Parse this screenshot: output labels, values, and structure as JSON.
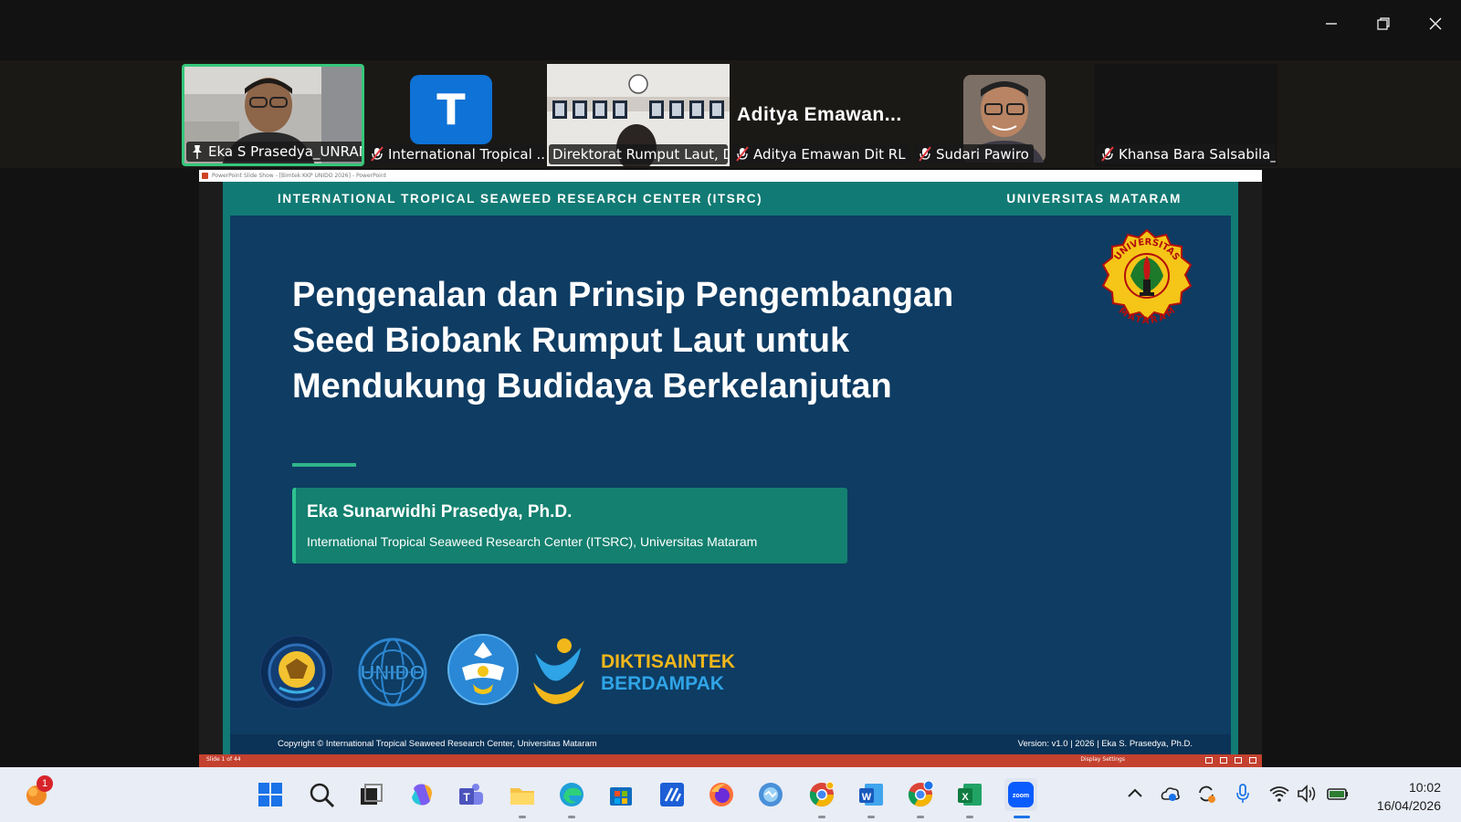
{
  "window": {
    "controls": [
      "minimize-icon",
      "restore-icon",
      "close-icon"
    ]
  },
  "participants": [
    {
      "name": "Eka S Prasedya_UNRAM",
      "mic": "pin-icon",
      "active": true,
      "video": "camera"
    },
    {
      "name": "International Tropical ...",
      "mic": "mic-muted-icon",
      "avatar_letter": "T"
    },
    {
      "name": "Direktorat Rumput Laut, D...",
      "mic": "none",
      "video": "camera"
    },
    {
      "name": "Aditya Emawan Dit RL",
      "mic": "mic-muted-icon",
      "big_name": "Aditya  Emawan..."
    },
    {
      "name": "Sudari Pawiro",
      "mic": "mic-muted-icon",
      "video": "photo"
    },
    {
      "name": "Khansa Bara Salsabila_...",
      "mic": "mic-muted-icon",
      "video": "off"
    }
  ],
  "powerpoint": {
    "titlebar": "PowerPoint Slide Show - [Bimtek KKP UNIDO 2026] - PowerPoint",
    "status_left": "Slide 1 of 44",
    "status_right": "Display Settings"
  },
  "slide": {
    "header_left": "INTERNATIONAL TROPICAL SEAWEED RESEARCH CENTER (ITSRC)",
    "header_right": "UNIVERSITAS MATARAM",
    "title_lines": [
      "Pengenalan dan Prinsip Pengembangan",
      "Seed Biobank Rumput Laut untuk",
      "Mendukung Budidaya Berkelanjutan"
    ],
    "author_name": "Eka Sunarwidhi Prasedya, Ph.D.",
    "author_affiliation": "International Tropical Seaweed Research Center (ITSRC), Universitas Mataram",
    "logo_top_text": "UNIVERSITAS",
    "logo_bottom_text": "MATARAM",
    "logos": [
      "kkp-logo",
      "unido-logo",
      "tut-wuri-handayani-logo",
      "diktisaintek-logo"
    ],
    "unido_text": "UNIDO",
    "dikti_line1": "DIKTISAINTEK",
    "dikti_line2": "BERDAMPAK",
    "footer_left": "Copyright © International Tropical Seaweed Research Center, Universitas Mataram",
    "footer_right": "Version: v1.0 | 2026 | Eka S. Prasedya, Ph.D."
  },
  "taskbar": {
    "notification_count": "1",
    "apps": [
      "start-icon",
      "search-icon",
      "task-view-icon",
      "copilot-icon",
      "teams-icon",
      "file-explorer-icon",
      "edge-icon",
      "store-icon",
      "zoom-workplace-icon",
      "firefox-icon",
      "network-app-icon",
      "chrome-icon",
      "word-icon",
      "chrome-profile-icon",
      "excel-icon",
      "zoom-icon"
    ],
    "time": "10:02",
    "date": "16/04/2026"
  },
  "colors": {
    "slide_teal": "#127a74",
    "slide_navy": "#0e3c63",
    "accent_green": "#2fb58a",
    "active_speaker": "#35c77a",
    "ppt_status_red": "#c4412f"
  }
}
